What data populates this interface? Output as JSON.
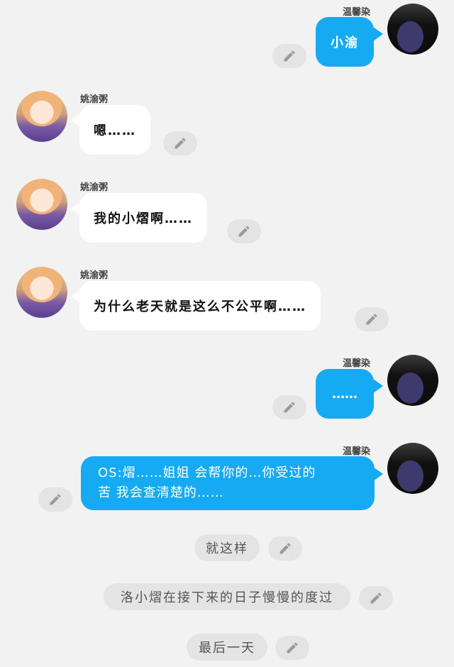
{
  "messages": [
    {
      "speaker": "温馨染",
      "text": "小渝"
    },
    {
      "speaker": "姚渝粥",
      "text": "嗯……"
    },
    {
      "speaker": "姚渝粥",
      "text": "我的小熠啊……"
    },
    {
      "speaker": "姚渝粥",
      "text": "为什么老天就是这么不公平啊……"
    },
    {
      "speaker": "温馨染",
      "text": "……"
    },
    {
      "speaker": "温馨染",
      "line1": "OS:熠……姐姐 会帮你的…你受过的",
      "line2": "苦 我会查清楚的……"
    }
  ],
  "narration": [
    {
      "text": "就这样"
    },
    {
      "text": "洛小熠在接下来的日子慢慢的度过"
    },
    {
      "text": "最后一天"
    }
  ],
  "colors": {
    "background": "#f2f2f2",
    "bubble_blue": "#16aaf2",
    "bubble_white": "#ffffff",
    "edit_button": "#e4e4e4"
  },
  "icons": {
    "edit": "pencil-icon"
  }
}
